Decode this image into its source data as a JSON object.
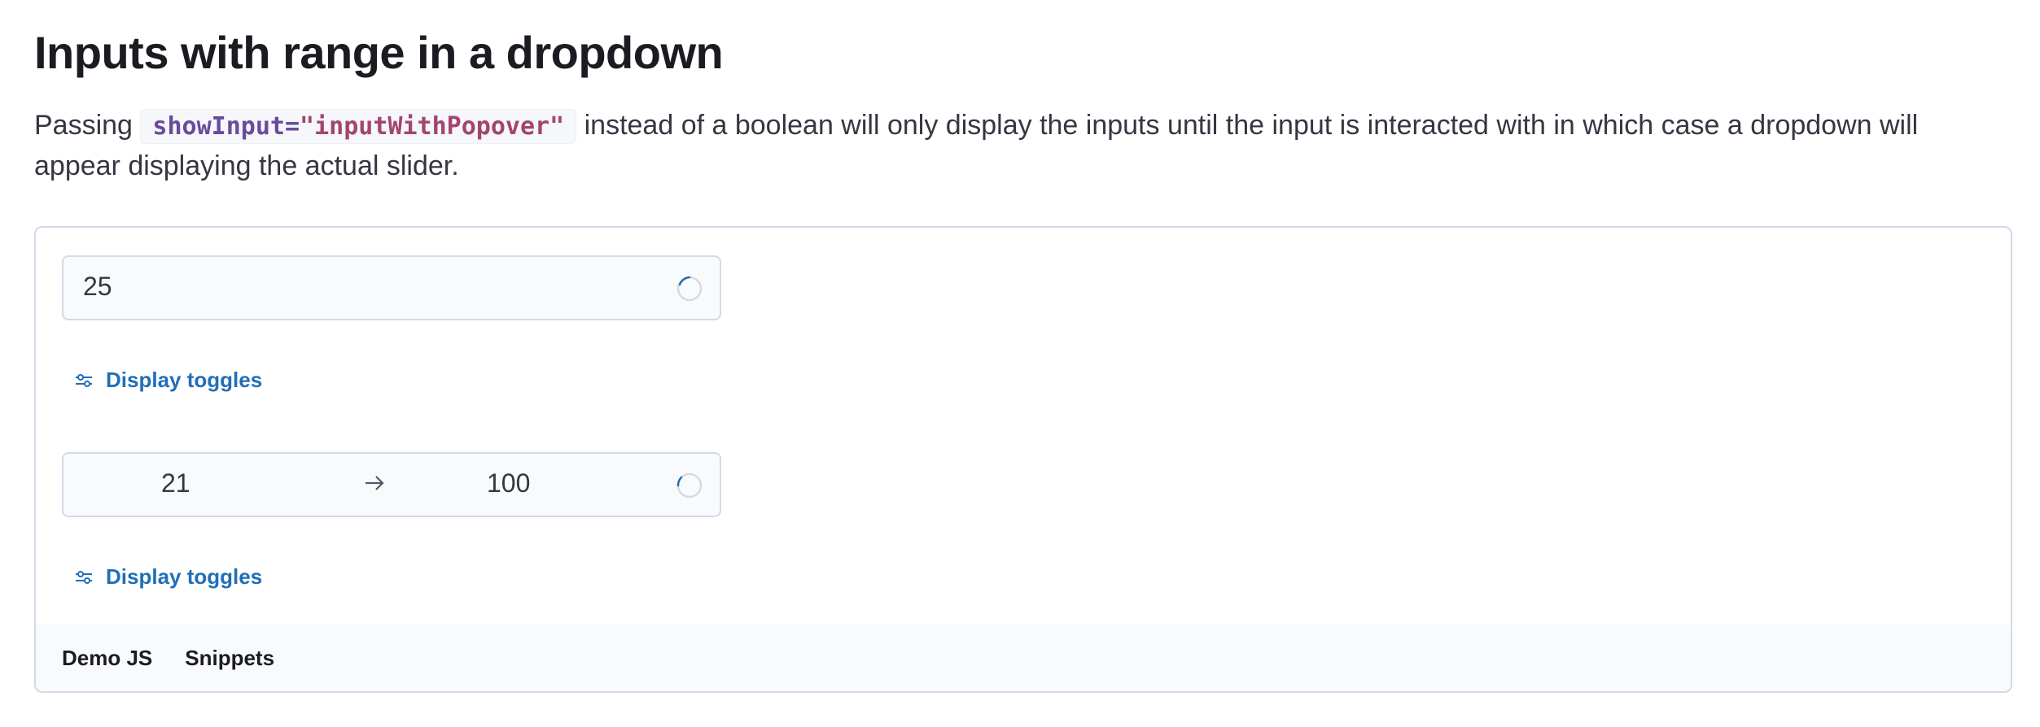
{
  "section": {
    "title": "Inputs with range in a dropdown",
    "description_before": "Passing",
    "code_attr": "showInput=",
    "code_value": "\"inputWithPopover\"",
    "description_after": "instead of a boolean will only display the inputs until the input is interacted with in which case a dropdown will appear displaying the actual slider."
  },
  "demo": {
    "single_value": "25",
    "range_lower": "21",
    "range_upper": "100",
    "toggle_label": "Display toggles",
    "icons": {
      "spinner": "loading-spinner-icon",
      "arrow": "arrow-right-icon",
      "toggles": "controls-icon"
    }
  },
  "footer": {
    "tabs": [
      "Demo JS",
      "Snippets"
    ]
  },
  "colors": {
    "link": "#1f6fb8",
    "border": "#d3dae6",
    "field_bg": "#f9fafc"
  }
}
